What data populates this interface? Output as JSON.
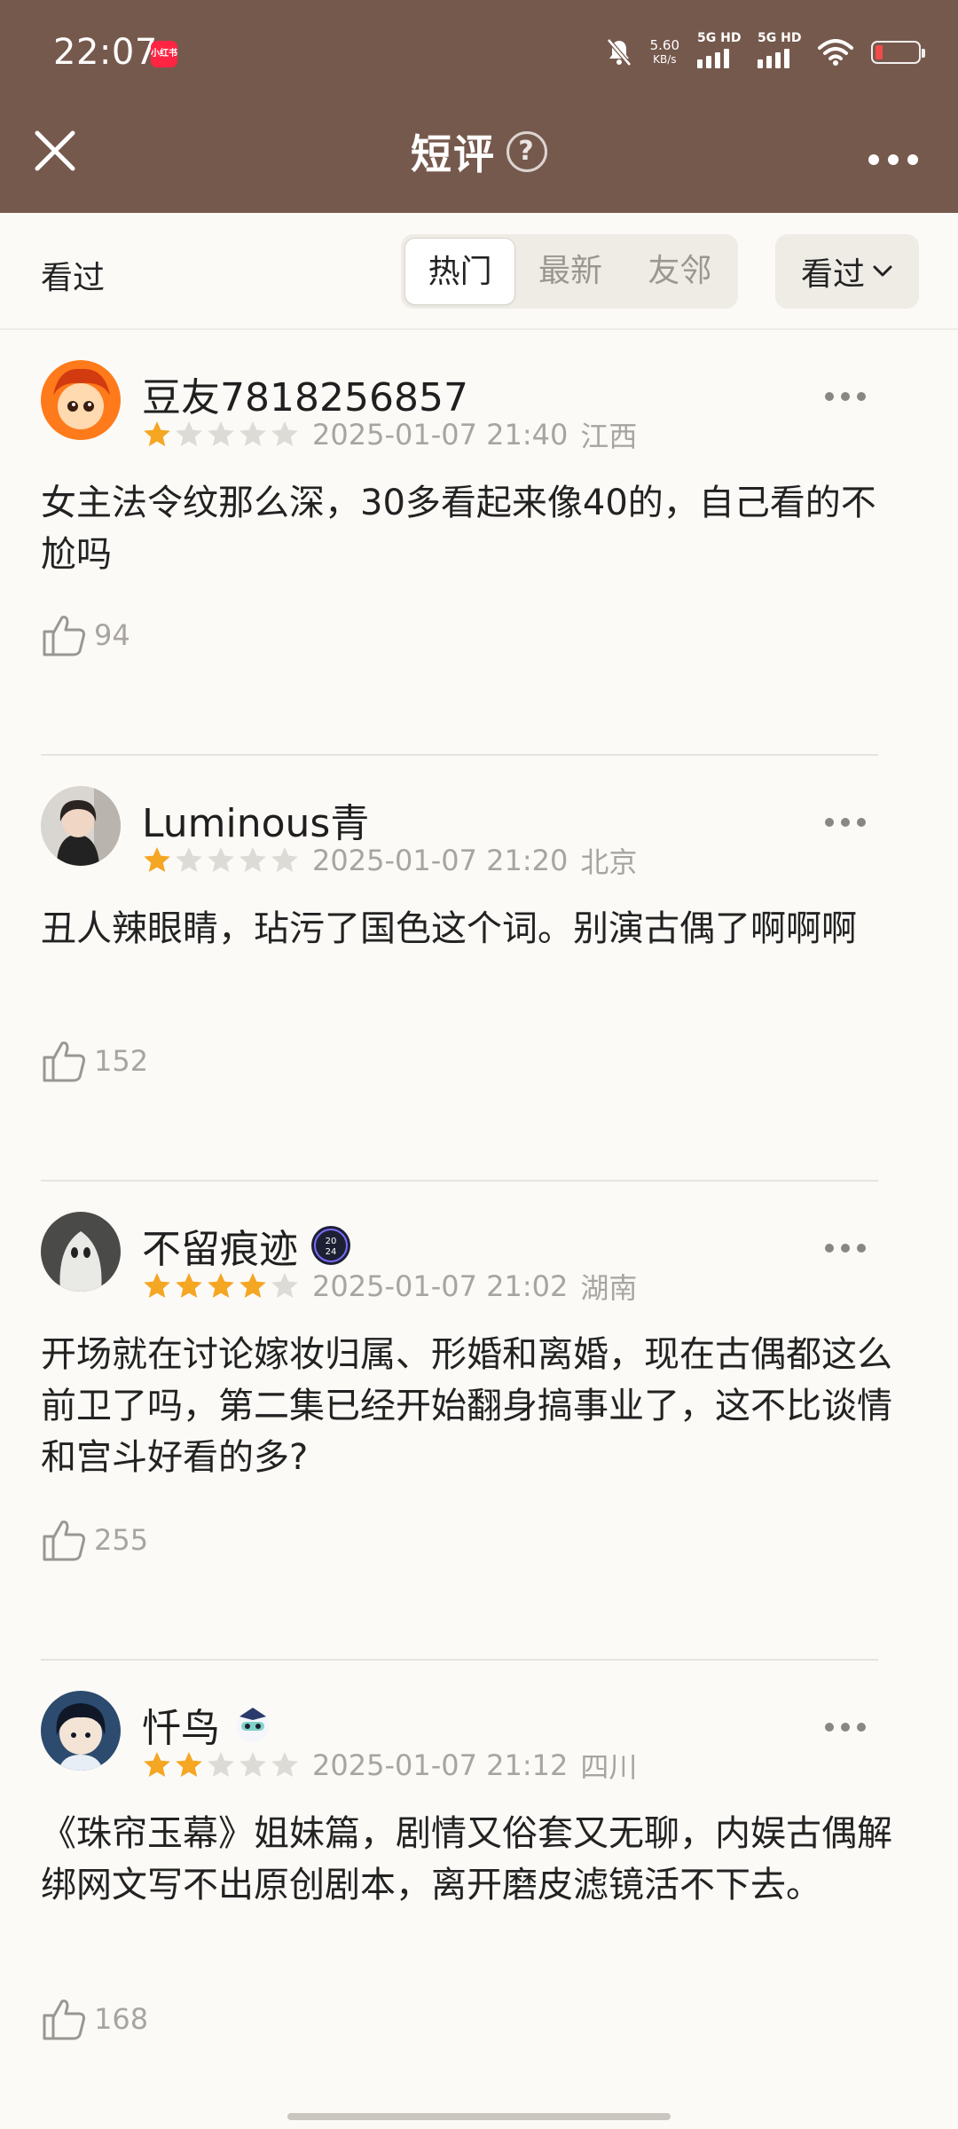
{
  "status_bar": {
    "time": "22:07",
    "app_badge": "小红书",
    "net_speed_value": "5.60",
    "net_speed_unit": "KB/s",
    "signal_1": "5G HD",
    "signal_2": "5G HD",
    "battery_color": "#ff4a4a"
  },
  "header": {
    "title": "短评",
    "help_symbol": "?",
    "background": "#76594d"
  },
  "filter": {
    "left_label": "看过",
    "tabs": [
      {
        "label": "热门",
        "active": true
      },
      {
        "label": "最新",
        "active": false
      },
      {
        "label": "友邻",
        "active": false
      }
    ],
    "sort_label": "看过"
  },
  "reviews": [
    {
      "username": "豆友7818256857",
      "rating": 1,
      "date": "2025-01-07 21:40",
      "location": "江西",
      "content": "女主法令纹那么深，30多看起来像40的，自己看的不尬吗",
      "likes": "94",
      "avatar": "orange-cartoon-avatar"
    },
    {
      "username": "Luminous青",
      "rating": 1,
      "date": "2025-01-07 21:20",
      "location": "北京",
      "content": "丑人辣眼睛，玷污了国色这个词。别演古偶了啊啊啊",
      "likes": "152",
      "avatar": "photo-portrait-avatar"
    },
    {
      "username": "不留痕迹",
      "rating": 4,
      "date": "2025-01-07 21:02",
      "location": "湖南",
      "content": "开场就在讨论嫁妆归属、形婚和离婚，现在古偶都这么前卫了吗，第二集已经开始翻身搞事业了，这不比谈情和宫斗好看的多?",
      "likes": "255",
      "avatar": "ghost-avatar",
      "badge": "2024-badge"
    },
    {
      "username": "忏鸟",
      "rating": 2,
      "date": "2025-01-07 21:12",
      "location": "四川",
      "content": "《珠帘玉幕》姐妹篇，剧情又俗套又无聊，内娱古偶解绑网文写不出原创剧本，离开磨皮滤镜活不下去。",
      "likes": "168",
      "avatar": "anime-avatar",
      "badge": "cartoon-badge"
    }
  ],
  "colors": {
    "star_filled": "#f5a623",
    "star_empty": "#dddbd6"
  }
}
